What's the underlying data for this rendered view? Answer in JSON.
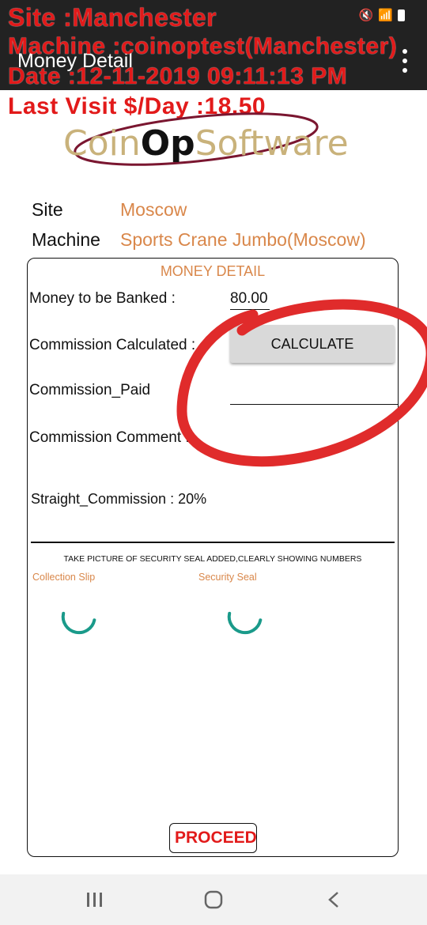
{
  "overlay": {
    "site": "Site :Manchester",
    "machine": "Machine :coinoptest(Manchester)",
    "date": "Date :12-11-2019 09:11:13 PM",
    "last_visit": "Last Visit $/Day :18.50"
  },
  "appbar": {
    "title": "Money Detail",
    "menu_icon": "more-vert-icon"
  },
  "logo": {
    "part1": "Coin",
    "part2": "Op",
    "part3": "Software"
  },
  "info": {
    "site_label": "Site",
    "site_value": "Moscow",
    "machine_label": "Machine",
    "machine_value": "Sports Crane Jumbo(Moscow)"
  },
  "card": {
    "title": "MONEY DETAIL",
    "money_label": "Money to be Banked :",
    "money_value": "80.00",
    "commission_calc_label": "Commission Calculated :",
    "calculate_button": "CALCULATE",
    "commission_paid_label": "Commission_Paid",
    "commission_comment_label": "Commission Comment :",
    "straight_commission": "Straight_Commission : 20%",
    "photo_caption": "TAKE PICTURE OF SECURITY SEAL ADDED,CLEARLY SHOWING NUMBERS",
    "collection_slip_label": "Collection Slip",
    "security_seal_label": "Security Seal",
    "proceed_button": "PROCEED"
  },
  "colors": {
    "accent": "#d9874a",
    "overlay_red": "#e21a1a",
    "spinner": "#1a9a8a"
  },
  "navbar": {
    "recent": "recent-apps-icon",
    "home": "home-icon",
    "back": "back-icon"
  }
}
